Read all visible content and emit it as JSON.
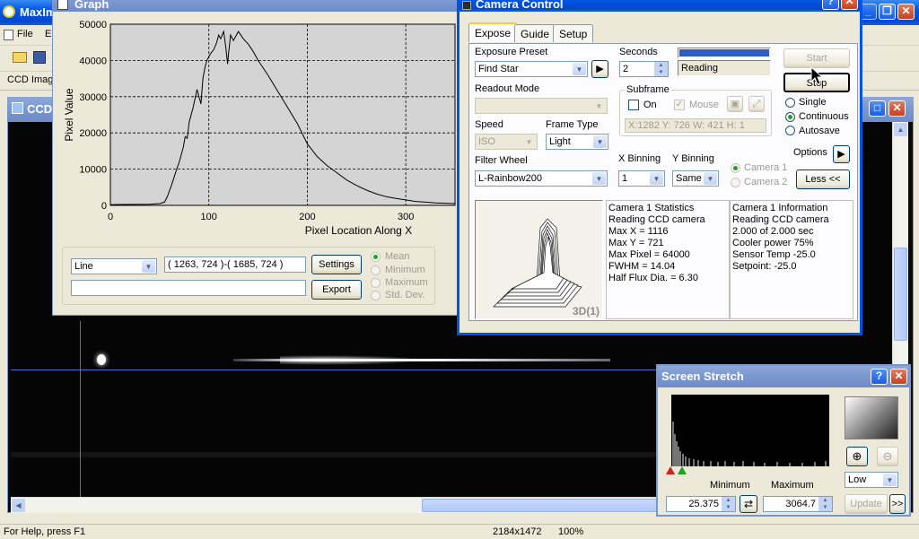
{
  "app": {
    "title": "MaxIm",
    "menu": {
      "file": "File",
      "edit": "E"
    },
    "tab_label": "CCD Imag",
    "doc_title": "CCD",
    "status": {
      "help": "For Help, press F1",
      "size": "2184x1472",
      "zoom": "100%"
    }
  },
  "graph": {
    "title": "Graph",
    "chart_data": {
      "type": "line",
      "xlabel": "Pixel Location Along X",
      "ylabel": "Pixel Value",
      "xlim": [
        0,
        350
      ],
      "ylim": [
        0,
        50000
      ],
      "xticks": [
        0,
        100,
        200,
        300
      ],
      "yticks": [
        0,
        10000,
        20000,
        30000,
        40000,
        50000
      ],
      "grid": true,
      "x": [
        0,
        40,
        50,
        55,
        58,
        62,
        65,
        68,
        70,
        72,
        74,
        76,
        78,
        80,
        84,
        88,
        90,
        92,
        94,
        96,
        98,
        100,
        102,
        105,
        108,
        110,
        112,
        115,
        117,
        119,
        120,
        122,
        125,
        130,
        135,
        140,
        145,
        150,
        160,
        170,
        180,
        190,
        200,
        210,
        220,
        230,
        240,
        250,
        260,
        270,
        280,
        290,
        300,
        310,
        320,
        330,
        340,
        350
      ],
      "y": [
        200,
        300,
        500,
        900,
        2500,
        5500,
        8000,
        10500,
        12000,
        14000,
        16000,
        19000,
        18500,
        23000,
        27000,
        32000,
        30000,
        28000,
        35000,
        38000,
        40000,
        41000,
        42000,
        43000,
        45000,
        47000,
        46000,
        48000,
        44000,
        39000,
        42000,
        47000,
        45500,
        48000,
        46000,
        44500,
        42500,
        40000,
        36000,
        31500,
        27000,
        22500,
        17000,
        13500,
        11000,
        9000,
        7000,
        5500,
        4200,
        3200,
        2400,
        1900,
        1500,
        1100,
        900,
        700,
        600,
        500
      ]
    },
    "mode": "Line",
    "coords": "( 1263, 724 )-( 1685, 724 )",
    "settings_label": "Settings",
    "export_label": "Export",
    "radios": [
      "Mean",
      "Minimum",
      "Maximum",
      "Std. Dev."
    ]
  },
  "camera": {
    "title": "Camera Control",
    "tabs": [
      "Expose",
      "Guide",
      "Setup"
    ],
    "exposure_preset_label": "Exposure Preset",
    "exposure_preset": "Find Star",
    "seconds_label": "Seconds",
    "seconds_value": "2",
    "reading": "Reading",
    "progress": 1.0,
    "start_label": "Start",
    "stop_label": "Stop",
    "single_label": "Single",
    "continuous_label": "Continuous",
    "autosave_label": "Autosave",
    "options_label": "Options",
    "less_label": "Less <<",
    "readout_mode_label": "Readout Mode",
    "subframe_label": "Subframe",
    "subframe_on": "On",
    "subframe_mouse": "Mouse",
    "subframe_coords": "X:1282 Y: 726 W: 421 H:  1",
    "speed_label": "Speed",
    "speed_value": "ISO",
    "frame_type_label": "Frame Type",
    "frame_type": "Light",
    "filter_wheel_label": "Filter Wheel",
    "filter_value": "L-Rainbow200",
    "xbin_label": "X Binning",
    "xbin_value": "1",
    "ybin_label": "Y Binning",
    "ybin_value": "Same",
    "camera1": "Camera 1",
    "camera2": "Camera 2",
    "preview_label": "3D(1)",
    "stats": [
      "Camera 1 Statistics",
      "Reading CCD camera",
      "Max X = 1116",
      "Max Y = 721",
      "Max Pixel = 64000",
      "FWHM = 14.04",
      "Half Flux Dia. = 6.30"
    ],
    "info": [
      "Camera 1 Information",
      "Reading CCD camera",
      "2.000 of 2.000 sec",
      "Cooler power 75%",
      "Sensor Temp -25.0",
      "Setpoint: -25.0"
    ]
  },
  "stretch": {
    "title": "Screen Stretch",
    "min_label": "Minimum",
    "max_label": "Maximum",
    "min_value": "25.375",
    "max_value": "3064.7",
    "level": "Low",
    "update_label": "Update",
    "more_label": ">>"
  }
}
